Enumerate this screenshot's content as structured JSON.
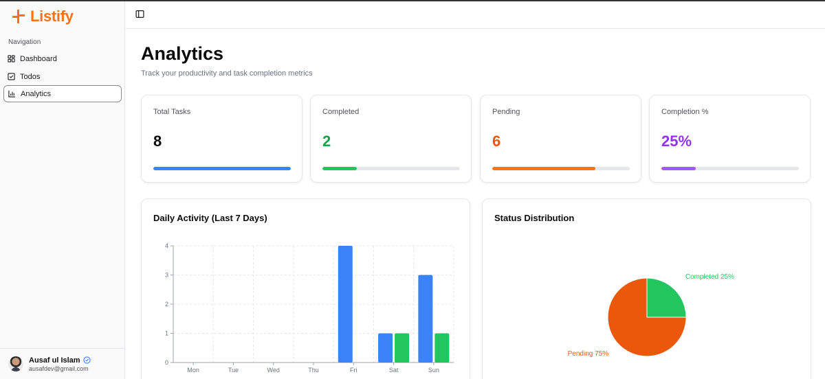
{
  "brand": {
    "name": "Listify",
    "color": "#f97316"
  },
  "sidebar": {
    "heading": "Navigation",
    "items": [
      {
        "label": "Dashboard",
        "icon": "dashboard-grid-icon",
        "active": false
      },
      {
        "label": "Todos",
        "icon": "checkbox-icon",
        "active": false
      },
      {
        "label": "Analytics",
        "icon": "bar-chart-icon",
        "active": true
      }
    ],
    "user": {
      "name": "Ausaf ul Islam",
      "email": "ausafdev@gmail.com",
      "verified_icon": "verified-badge-icon"
    }
  },
  "topbar": {
    "toggle_icon": "sidebar-toggle-icon"
  },
  "page": {
    "title": "Analytics",
    "subtitle": "Track your productivity and task completion metrics"
  },
  "stats": [
    {
      "label": "Total Tasks",
      "value": "8",
      "progress": 1.0,
      "color": "#3b82f6",
      "value_color": "#0a0a0a"
    },
    {
      "label": "Completed",
      "value": "2",
      "progress": 0.25,
      "color": "#22c55e",
      "value_color": "#16a34a"
    },
    {
      "label": "Pending",
      "value": "6",
      "progress": 0.75,
      "color": "#f97316",
      "value_color": "#ea580c"
    },
    {
      "label": "Completion %",
      "value": "25%",
      "progress": 0.25,
      "color": "#a855f7",
      "value_color": "#9333ea"
    }
  ],
  "panels": {
    "daily_title": "Daily Activity (Last 7 Days)",
    "status_title": "Status Distribution"
  },
  "chart_data": [
    {
      "type": "bar",
      "title": "Daily Activity (Last 7 Days)",
      "categories": [
        "Mon",
        "Tue",
        "Wed",
        "Thu",
        "Fri",
        "Sat",
        "Sun"
      ],
      "series": [
        {
          "color": "#3b82f6",
          "values": [
            0,
            0,
            0,
            0,
            4,
            1,
            3
          ]
        },
        {
          "color": "#22c55e",
          "values": [
            0,
            0,
            0,
            0,
            0,
            1,
            1
          ]
        }
      ],
      "ylim": [
        0,
        4
      ],
      "yticks": [
        "0",
        "1",
        "2",
        "3",
        "4"
      ],
      "grid": true
    },
    {
      "type": "pie",
      "title": "Status Distribution",
      "slices": [
        {
          "label": "Completed 25%",
          "value": 25,
          "color": "#22c55e"
        },
        {
          "label": "Pending 75%",
          "value": 75,
          "color": "#ea580c"
        }
      ]
    }
  ]
}
